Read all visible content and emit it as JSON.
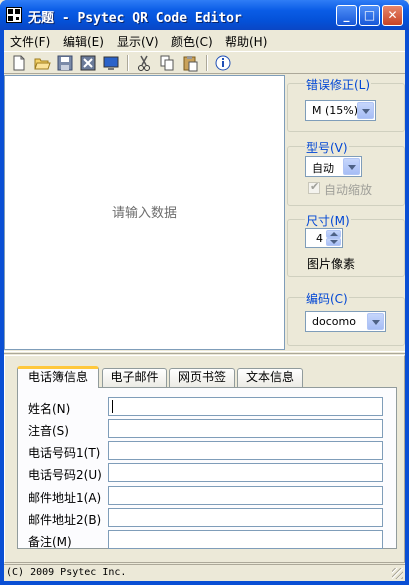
{
  "window": {
    "title": "无题 - Psytec QR Code Editor",
    "min_symbol": "_",
    "max_symbol": "□",
    "close_symbol": "✕"
  },
  "menu": [
    "文件(F)",
    "编辑(E)",
    "显示(V)",
    "颜色(C)",
    "帮助(H)"
  ],
  "toolbar": {
    "icons": [
      "new-icon",
      "open-icon",
      "save-icon",
      "save-image-icon",
      "display-icon",
      "cut-icon",
      "copy-icon",
      "paste-icon",
      "info-icon"
    ]
  },
  "preview": {
    "placeholder": "请输入数据"
  },
  "settings": {
    "error_correction": {
      "label": "错误修正(L)",
      "value": "M (15%)"
    },
    "model": {
      "label": "型号(V)",
      "value": "自动",
      "auto_shrink": "自动缩放",
      "auto_shrink_checked": true,
      "auto_shrink_enabled": false
    },
    "size": {
      "label": "尺寸(M)",
      "value": "4",
      "unit": "图片像素"
    },
    "encoding": {
      "label": "编码(C)",
      "value": "docomo"
    }
  },
  "tabs": [
    {
      "label": "电话簿信息",
      "active": true
    },
    {
      "label": "电子邮件",
      "active": false
    },
    {
      "label": "网页书签",
      "active": false
    },
    {
      "label": "文本信息",
      "active": false
    }
  ],
  "form": {
    "fields": [
      {
        "label": "姓名(N)",
        "value": ""
      },
      {
        "label": "注音(S)",
        "value": ""
      },
      {
        "label": "电话号码1(T)",
        "value": ""
      },
      {
        "label": "电话号码2(U)",
        "value": ""
      },
      {
        "label": "邮件地址1(A)",
        "value": ""
      },
      {
        "label": "邮件地址2(B)",
        "value": ""
      },
      {
        "label": "备注(M)",
        "value": ""
      }
    ]
  },
  "status": {
    "text": "(C) 2009 Psytec Inc."
  },
  "colors": {
    "titlebar": "#0a5ce6",
    "group_label": "#0046d5",
    "tab_highlight": "#ffc83c",
    "face": "#ece9d8"
  }
}
